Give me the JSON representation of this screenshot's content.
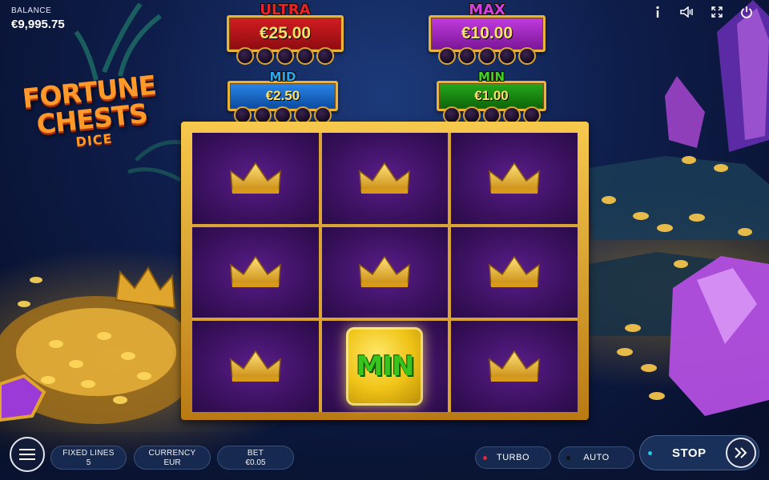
{
  "balance": {
    "label": "BALANCE",
    "value": "€9,995.75"
  },
  "top_icons": [
    "info-icon",
    "sound-icon",
    "fullscreen-icon",
    "power-icon"
  ],
  "logo": {
    "line1": "FORTUNE",
    "line2": "CHESTS",
    "line3": "DICE"
  },
  "jackpots": {
    "ultra": {
      "name": "ULTRA",
      "value": "€25.00",
      "color": "#c0151a"
    },
    "max": {
      "name": "MAX",
      "value": "€10.00",
      "color": "#b02ac8"
    },
    "mid": {
      "name": "MID",
      "value": "€2.50",
      "color": "#1a6fd6"
    },
    "min": {
      "name": "MIN",
      "value": "€1.00",
      "color": "#1c8e16"
    }
  },
  "reels": {
    "cells": [
      "crown",
      "crown",
      "crown",
      "crown",
      "crown",
      "crown",
      "crown",
      "MIN",
      "crown"
    ]
  },
  "controls": {
    "fixed_lines": {
      "label": "FIXED LINES",
      "value": "5"
    },
    "currency": {
      "label": "CURRENCY",
      "value": "EUR"
    },
    "bet": {
      "label": "BET",
      "value": "€0.05"
    },
    "turbo": {
      "label": "TURBO",
      "indicator_color": "#e0283a"
    },
    "auto": {
      "label": "AUTO",
      "indicator_color": "#111111"
    },
    "stop": {
      "label": "STOP",
      "indicator_color": "#1ecbe8"
    }
  }
}
